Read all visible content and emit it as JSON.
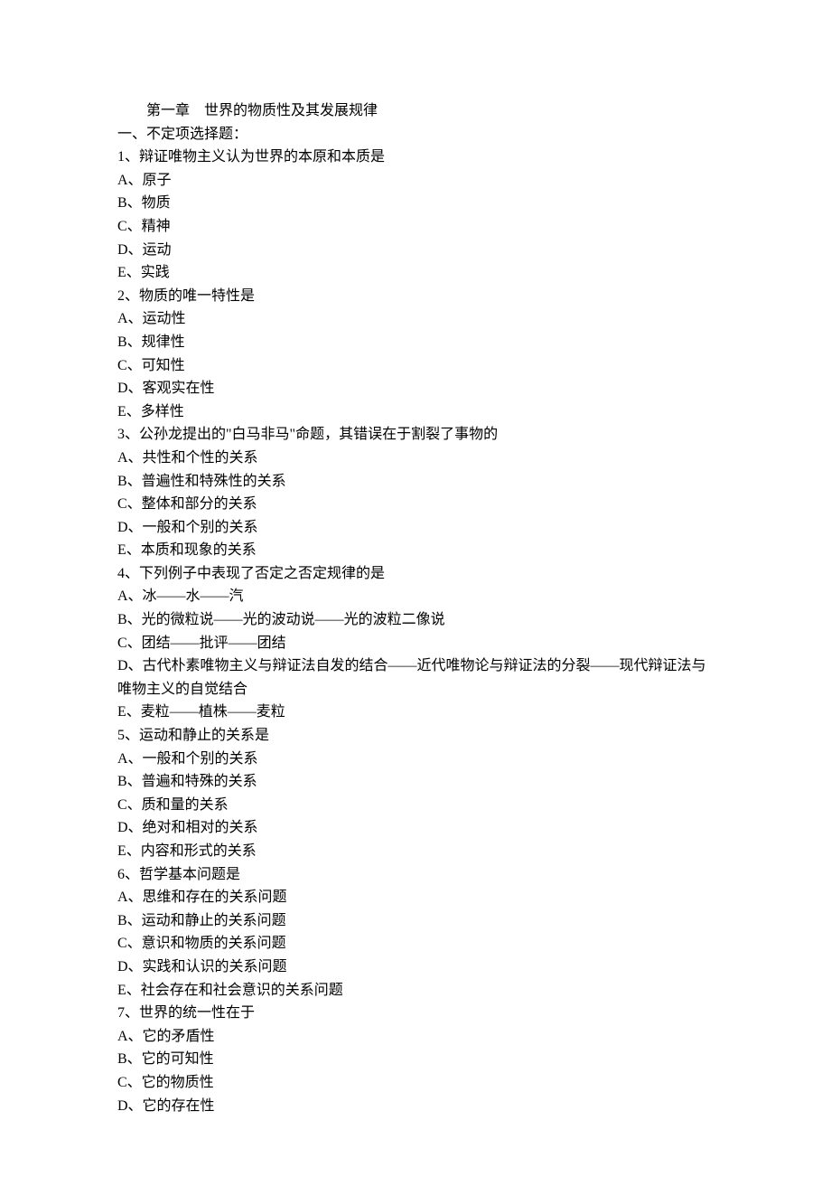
{
  "chapter_title": "第一章　世界的物质性及其发展规律",
  "section_heading": "一、不定项选择题：",
  "questions": [
    {
      "stem": "1、辩证唯物主义认为世界的本原和本质是",
      "options": [
        "A、原子",
        "B、物质",
        "C、精神",
        "D、运动",
        "E、实践"
      ]
    },
    {
      "stem": "2、物质的唯一特性是",
      "options": [
        "A、运动性",
        "B、规律性",
        "C、可知性",
        "D、客观实在性",
        "E、多样性"
      ]
    },
    {
      "stem": "3、公孙龙提出的\"白马非马\"命题，其错误在于割裂了事物的",
      "options": [
        "A、共性和个性的关系",
        "B、普遍性和特殊性的关系",
        "C、整体和部分的关系",
        "D、一般和个别的关系",
        "E、本质和现象的关系"
      ]
    },
    {
      "stem": "4、下列例子中表现了否定之否定规律的是",
      "options": [
        "A、冰——水——汽",
        "B、光的微粒说——光的波动说——光的波粒二像说",
        "C、团结——批评——团结",
        "D、古代朴素唯物主义与辩证法自发的结合——近代唯物论与辩证法的分裂——现代辩证法与唯物主义的自觉结合",
        "E、麦粒——植株——麦粒"
      ]
    },
    {
      "stem": "5、运动和静止的关系是",
      "options": [
        "A、一般和个别的关系",
        "B、普遍和特殊的关系",
        "C、质和量的关系",
        "D、绝对和相对的关系",
        "E、内容和形式的关系"
      ]
    },
    {
      "stem": "6、哲学基本问题是",
      "options": [
        "A、思维和存在的关系问题",
        "B、运动和静止的关系问题",
        "C、意识和物质的关系问题",
        "D、实践和认识的关系问题",
        "E、社会存在和社会意识的关系问题"
      ]
    },
    {
      "stem": "7、世界的统一性在于",
      "options": [
        "A、它的矛盾性",
        "B、它的可知性",
        "C、它的物质性",
        "D、它的存在性"
      ]
    }
  ]
}
